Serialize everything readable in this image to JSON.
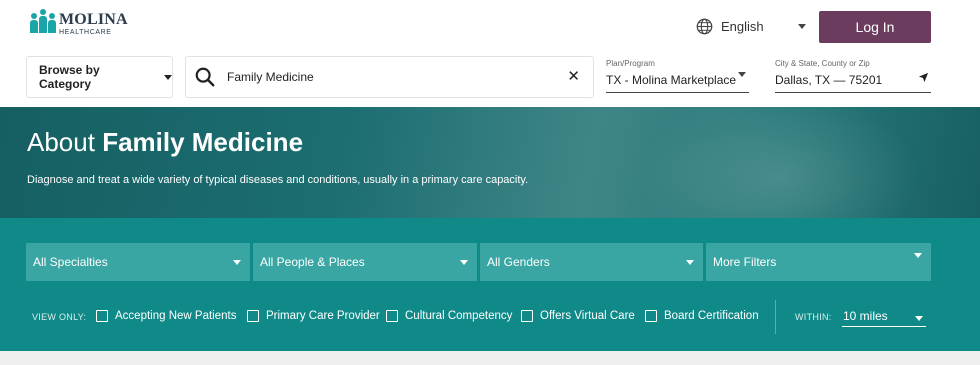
{
  "header": {
    "logo_main": "MOLINA",
    "logo_sub": "HEALTHCARE",
    "language": "English",
    "login_label": "Log In",
    "login_color": "#6b3c5e"
  },
  "search_bar": {
    "browse_label": "Browse by Category",
    "search_value": "Family Medicine",
    "clear_icon": "close-icon",
    "plan_label": "Plan/Program",
    "plan_value": "TX - Molina Marketplace",
    "city_label": "City & State, County or Zip",
    "city_value": "Dallas, TX — 75201"
  },
  "hero": {
    "title_prefix": "About",
    "title_bold": "Family Medicine",
    "description": "Diagnose and treat a wide variety of typical diseases and conditions, usually in a primary care capacity."
  },
  "filters": {
    "dropdowns": [
      {
        "label": "All Specialties"
      },
      {
        "label": "All People & Places"
      },
      {
        "label": "All Genders"
      },
      {
        "label": "More Filters"
      }
    ],
    "view_only_label": "VIEW ONLY:",
    "checkboxes": [
      {
        "label": "Accepting New Patients",
        "checked": false
      },
      {
        "label": "Primary Care Provider",
        "checked": false
      },
      {
        "label": "Cultural Competency",
        "checked": false
      },
      {
        "label": "Offers Virtual Care",
        "checked": false
      },
      {
        "label": "Board Certification",
        "checked": false
      }
    ],
    "within_label": "WITHIN:",
    "within_value": "10 miles",
    "band_color": "#0f8a88"
  }
}
